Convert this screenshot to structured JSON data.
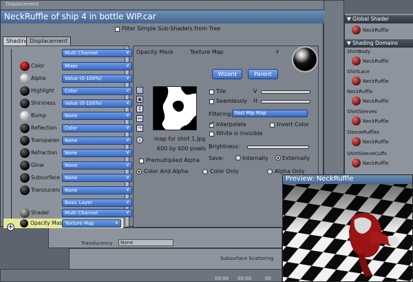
{
  "background": {
    "top_tab": "Displacement",
    "bottom_translucency_label": "Translucency",
    "bottom_translucency_value": "None",
    "bottom_sss_label": "Subsurface Scattering",
    "bottom_numbers_1": "00:00",
    "bottom_numbers_2": "00:00",
    "bottom_numbers_3": "00"
  },
  "editor": {
    "title": "NeckRuffle of ship 4 in bottle WIP.car",
    "filter_label": "Filter Simple Sub-Shaders from Tree",
    "tabs": [
      {
        "label": "Shading"
      },
      {
        "label": "Displacement"
      }
    ]
  },
  "node_rows": [
    {
      "label": "",
      "value": "Multi Channel"
    },
    {
      "label": "Color",
      "value": "Mixer"
    },
    {
      "label": "Alpha",
      "value": "Value (0-100%)"
    },
    {
      "label": "Highlight",
      "value": "Color"
    },
    {
      "label": "Shininess",
      "value": "Value (0-100%)"
    },
    {
      "label": "Bump",
      "value": "None"
    },
    {
      "label": "Reflection",
      "value": "Color"
    },
    {
      "label": "Transparency",
      "value": "None"
    },
    {
      "label": "Refraction",
      "value": "None"
    },
    {
      "label": "Glow",
      "value": "None"
    },
    {
      "label": "Subsurface Sc",
      "value": "None"
    },
    {
      "label": "Translucency",
      "value": "None"
    },
    {
      "label": "",
      "value": "Basic Layer"
    },
    {
      "label": "Shader",
      "value": "Multi Channel"
    },
    {
      "label": "Opacity Mask",
      "value": "Texture Map"
    }
  ],
  "texture_panel": {
    "channel_label": "Opacity Mask",
    "type_label": "Texture Map",
    "wizard_button": "Wizard",
    "parent_button": "Parent",
    "map_name": "map for shirt 1.jpg",
    "map_size": "600 by 600 pixels",
    "tile_label": "Tile",
    "seamlessly_label": "Seamlessly",
    "v_label": "V",
    "h_label": "H",
    "filtering_label": "Filtering:",
    "filtering_value": "Fast Mip Map",
    "interpolate_label": "Interpolate",
    "invert_label": "Invert Color",
    "white_invisible_label": "White is invisible",
    "brightness_label": "Brightness:",
    "save_label": "Save:",
    "internally_label": "Internally",
    "externally_label": "Externally",
    "premult_label": "Premultiplied Alpha",
    "color_alpha_label": "Color And Alpha",
    "color_only_label": "Color Only",
    "alpha_only_label": "Alpha Only",
    "tile_checked": false,
    "seamlessly_checked": false,
    "interpolate_checked": true,
    "invert_checked": false,
    "white_invisible_checked": false,
    "premult_checked": false,
    "save_selected": "Externally",
    "channel_selected": "Color And Alpha"
  },
  "sidebar": {
    "global_header": "Global Shader",
    "global_item": "NeckRuffle",
    "domains_header": "Shading Domains",
    "domains": [
      {
        "name": "ShirtBody",
        "shader": "NeckRuffle"
      },
      {
        "name": "ShirtLace",
        "shader": "NeckRuffle"
      },
      {
        "name": "NeckRuffle",
        "shader": "NeckRuffle"
      },
      {
        "name": "ShirtSleeves",
        "shader": "NeckRuffle"
      },
      {
        "name": "SleeveRuffles",
        "shader": "NeckRuffle"
      },
      {
        "name": "ShirtSleeveCuffs",
        "shader": "NeckRuffle"
      }
    ]
  },
  "preview": {
    "title": "Preview: NeckRuffle"
  },
  "colors": {
    "title_blue": "#4f72a0",
    "select_blue": "#3b6cc4",
    "highlight_yellow": "#e8e89a",
    "shader_red": "#a01818"
  }
}
